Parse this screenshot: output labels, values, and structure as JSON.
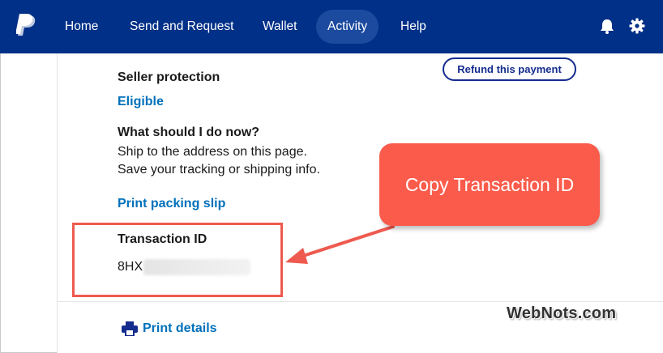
{
  "nav": {
    "items": [
      {
        "label": "Home"
      },
      {
        "label": "Send and Request"
      },
      {
        "label": "Wallet"
      },
      {
        "label": "Activity",
        "active": true
      },
      {
        "label": "Help"
      }
    ],
    "icons": [
      "bell-icon",
      "gear-icon"
    ]
  },
  "actions": {
    "refund_label": "Refund this payment"
  },
  "seller_protection": {
    "heading": "Seller protection",
    "status": "Eligible"
  },
  "next_steps": {
    "heading": "What should I do now?",
    "line1": "Ship to the address on this page.",
    "line2": "Save your tracking or shipping info."
  },
  "packing_slip": {
    "label": "Print packing slip"
  },
  "transaction": {
    "heading": "Transaction ID",
    "value_visible": "8HX"
  },
  "callout": {
    "text": "Copy Transaction ID",
    "color": "#fb5b4b"
  },
  "print_details": {
    "label": "Print details"
  },
  "watermark": {
    "text": "WebNots.com"
  },
  "colors": {
    "nav_bg": "#003087",
    "link": "#0070ba",
    "highlight": "#ee5a4f"
  }
}
